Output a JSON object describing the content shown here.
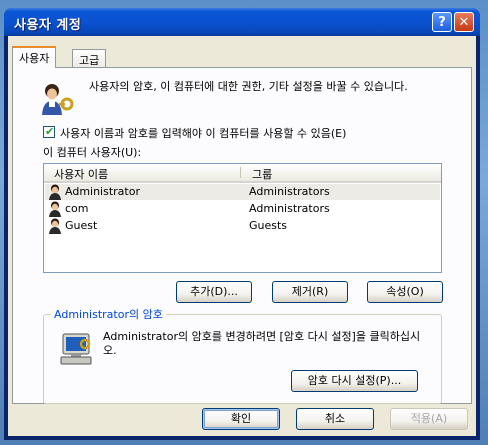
{
  "window": {
    "title": "사용자 계정",
    "help_label": "?",
    "close_label": "✕"
  },
  "tabs": [
    {
      "label": "사용자"
    },
    {
      "label": "고급"
    }
  ],
  "users_tab": {
    "description": "사용자의 암호, 이 컴퓨터에 대한 권한, 기타 설정을 바꿀 수 있습니다.",
    "require_login_checkbox": {
      "label": "사용자 이름과 암호를 입력해야 이 컴퓨터를 사용할 수 있음(E)",
      "checked": true
    },
    "users_label": "이 컴퓨터 사용자(U):",
    "columns": {
      "name": "사용자 이름",
      "group": "그룹"
    },
    "users": [
      {
        "name": "Administrator",
        "group": "Administrators",
        "selected": true
      },
      {
        "name": "com",
        "group": "Administrators",
        "selected": false
      },
      {
        "name": "Guest",
        "group": "Guests",
        "selected": false
      }
    ],
    "add_button": "추가(D)...",
    "remove_button": "제거(R)",
    "properties_button": "속성(O)",
    "password_group": {
      "title": "Administrator의 암호",
      "description": "Administrator의 암호를 변경하려면 [암호 다시 설정]을 클릭하십시오.",
      "reset_button": "암호 다시 설정(P)..."
    }
  },
  "dialog_buttons": {
    "ok": "확인",
    "cancel": "취소",
    "apply": "적용(A)"
  },
  "colors": {
    "title_bar": "#0a52cf",
    "dialog_bg": "#ece9d8",
    "tab_accent": "#e68b2c",
    "group_title": "#0046d5"
  }
}
